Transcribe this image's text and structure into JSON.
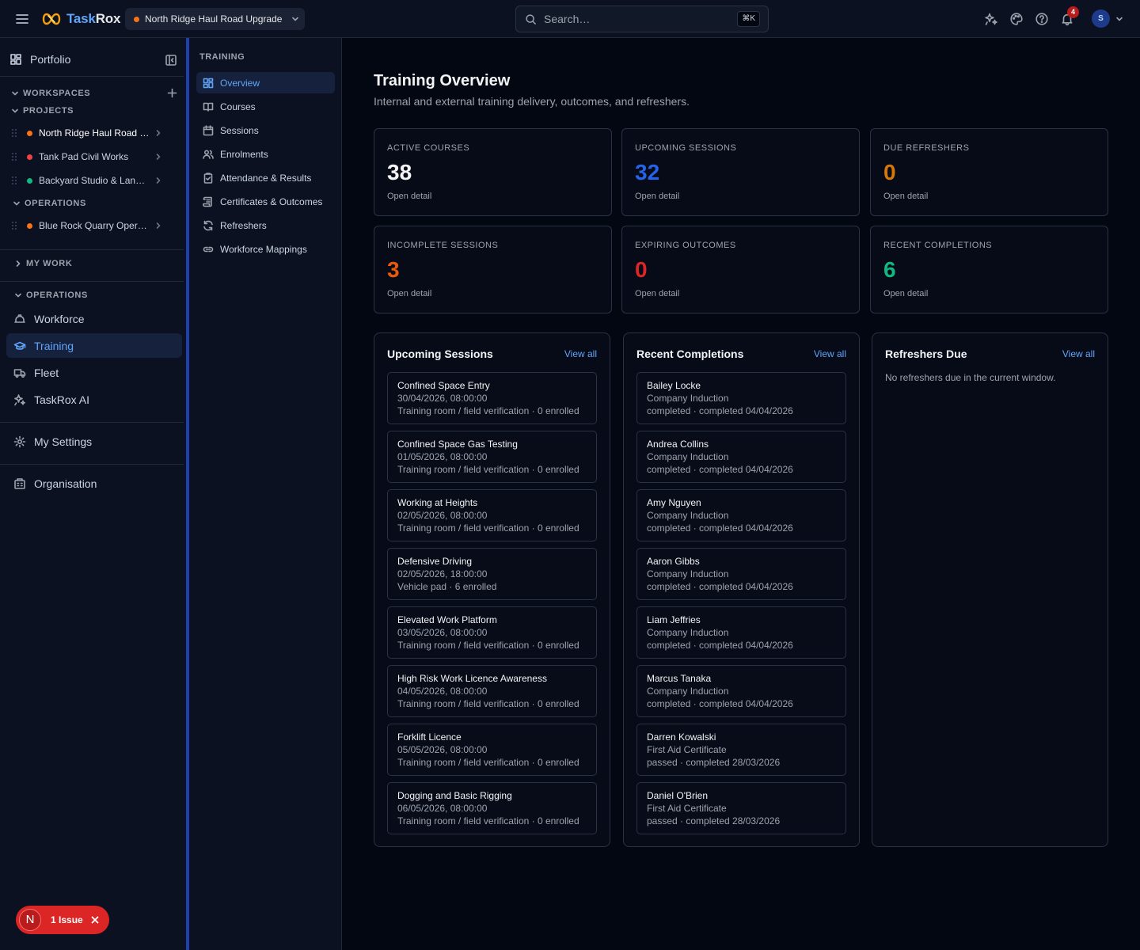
{
  "app": {
    "brand_a": "Task",
    "brand_b": "Rox"
  },
  "topbar": {
    "project": "North Ridge Haul Road Upgrade",
    "project_color": "#f97316",
    "search_placeholder": "Search…",
    "search_shortcut": "⌘K",
    "notifications_count": "4",
    "avatar": "S",
    "icons": [
      "menu-icon",
      "sparkles-icon",
      "palette-icon",
      "help-icon",
      "bell-icon",
      "chevron-down-icon"
    ]
  },
  "sidebar": {
    "portfolio": "Portfolio",
    "workspaces": "WORKSPACES",
    "projects_header": "PROJECTS",
    "projects": [
      {
        "label": "North Ridge Haul Road Upgrade",
        "color": "#f97316"
      },
      {
        "label": "Tank Pad Civil Works",
        "color": "#ef4444"
      },
      {
        "label": "Backyard Studio & Landscaping",
        "color": "#10b981"
      }
    ],
    "operations_header": "OPERATIONS",
    "operations_projects": [
      {
        "label": "Blue Rock Quarry Operations",
        "color": "#f97316"
      }
    ],
    "my_work": "MY WORK",
    "operations_nav_header": "OPERATIONS",
    "nav": [
      {
        "label": "Workforce",
        "icon": "hard-hat-icon"
      },
      {
        "label": "Training",
        "icon": "graduation-cap-icon"
      },
      {
        "label": "Fleet",
        "icon": "truck-icon"
      },
      {
        "label": "TaskRox AI",
        "icon": "sparkles-icon"
      }
    ],
    "settings": "My Settings",
    "organisation": "Organisation",
    "issue": {
      "badge": "N",
      "label": "1 Issue"
    }
  },
  "subnav": {
    "title": "TRAINING",
    "items": [
      {
        "label": "Overview",
        "icon": "dashboard-icon"
      },
      {
        "label": "Courses",
        "icon": "book-icon"
      },
      {
        "label": "Sessions",
        "icon": "calendar-icon"
      },
      {
        "label": "Enrolments",
        "icon": "users-icon"
      },
      {
        "label": "Attendance & Results",
        "icon": "clipboard-check-icon"
      },
      {
        "label": "Certificates & Outcomes",
        "icon": "scroll-icon"
      },
      {
        "label": "Refreshers",
        "icon": "refresh-icon"
      },
      {
        "label": "Workforce Mappings",
        "icon": "link-icon"
      }
    ]
  },
  "page": {
    "title": "Training Overview",
    "subtitle": "Internal and external training delivery, outcomes, and refreshers."
  },
  "stats": [
    {
      "label": "ACTIVE COURSES",
      "value": "38",
      "link": "Open detail",
      "color": "#f3f4f6"
    },
    {
      "label": "UPCOMING SESSIONS",
      "value": "32",
      "link": "Open detail",
      "color": "#2563eb"
    },
    {
      "label": "DUE REFRESHERS",
      "value": "0",
      "link": "Open detail",
      "color": "#d97706"
    },
    {
      "label": "INCOMPLETE SESSIONS",
      "value": "3",
      "link": "Open detail",
      "color": "#ea580c"
    },
    {
      "label": "EXPIRING OUTCOMES",
      "value": "0",
      "link": "Open detail",
      "color": "#dc2626"
    },
    {
      "label": "RECENT COMPLETIONS",
      "value": "6",
      "link": "Open detail",
      "color": "#10b981"
    }
  ],
  "upcoming": {
    "title": "Upcoming Sessions",
    "view_all": "View all",
    "items": [
      {
        "title": "Confined Space Entry",
        "date": "30/04/2026, 08:00:00",
        "meta": "Training room / field verification · 0 enrolled"
      },
      {
        "title": "Confined Space Gas Testing",
        "date": "01/05/2026, 08:00:00",
        "meta": "Training room / field verification · 0 enrolled"
      },
      {
        "title": "Working at Heights",
        "date": "02/05/2026, 08:00:00",
        "meta": "Training room / field verification · 0 enrolled"
      },
      {
        "title": "Defensive Driving",
        "date": "02/05/2026, 18:00:00",
        "meta": "Vehicle pad · 6 enrolled"
      },
      {
        "title": "Elevated Work Platform",
        "date": "03/05/2026, 08:00:00",
        "meta": "Training room / field verification · 0 enrolled"
      },
      {
        "title": "High Risk Work Licence Awareness",
        "date": "04/05/2026, 08:00:00",
        "meta": "Training room / field verification · 0 enrolled"
      },
      {
        "title": "Forklift Licence",
        "date": "05/05/2026, 08:00:00",
        "meta": "Training room / field verification · 0 enrolled"
      },
      {
        "title": "Dogging and Basic Rigging",
        "date": "06/05/2026, 08:00:00",
        "meta": "Training room / field verification · 0 enrolled"
      }
    ]
  },
  "completions": {
    "title": "Recent Completions",
    "view_all": "View all",
    "items": [
      {
        "name": "Bailey Locke",
        "course": "Company Induction",
        "status": "completed · completed 04/04/2026"
      },
      {
        "name": "Andrea Collins",
        "course": "Company Induction",
        "status": "completed · completed 04/04/2026"
      },
      {
        "name": "Amy Nguyen",
        "course": "Company Induction",
        "status": "completed · completed 04/04/2026"
      },
      {
        "name": "Aaron Gibbs",
        "course": "Company Induction",
        "status": "completed · completed 04/04/2026"
      },
      {
        "name": "Liam Jeffries",
        "course": "Company Induction",
        "status": "completed · completed 04/04/2026"
      },
      {
        "name": "Marcus Tanaka",
        "course": "Company Induction",
        "status": "completed · completed 04/04/2026"
      },
      {
        "name": "Darren Kowalski",
        "course": "First Aid Certificate",
        "status": "passed · completed 28/03/2026"
      },
      {
        "name": "Daniel O'Brien",
        "course": "First Aid Certificate",
        "status": "passed · completed 28/03/2026"
      }
    ]
  },
  "refreshers": {
    "title": "Refreshers Due",
    "view_all": "View all",
    "empty": "No refreshers due in the current window."
  }
}
